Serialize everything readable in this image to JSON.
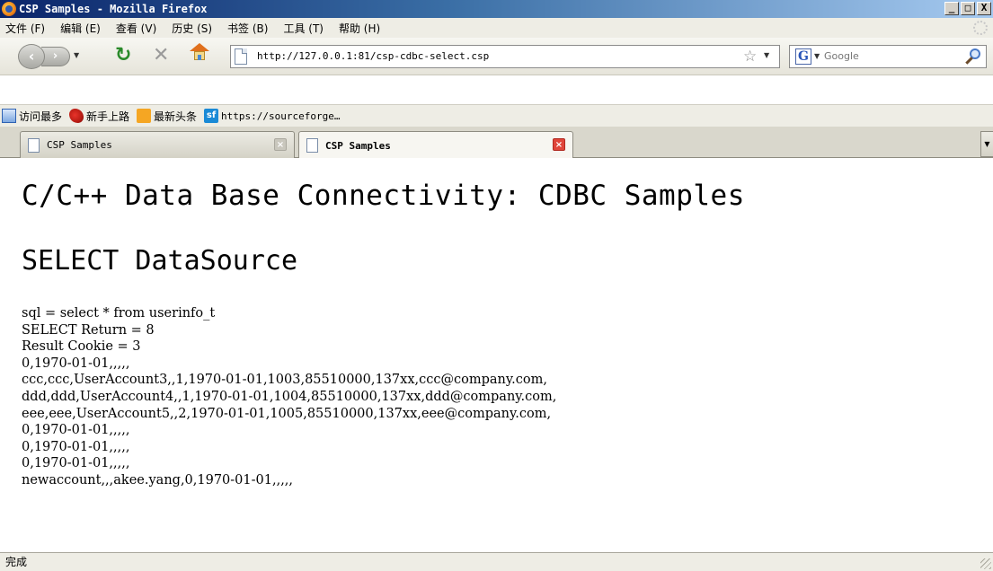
{
  "window": {
    "title": "CSP Samples - Mozilla Firefox",
    "controls": {
      "minimize": "_",
      "maximize": "□",
      "close": "X"
    }
  },
  "menu": [
    "文件 (F)",
    "编辑 (E)",
    "查看 (V)",
    "历史 (S)",
    "书签 (B)",
    "工具 (T)",
    "帮助 (H)"
  ],
  "nav": {
    "url": "http://127.0.0.1:81/csp-cdbc-select.csp",
    "search_placeholder": "Google",
    "search_engine_letter": "G",
    "icons": [
      "back-icon",
      "forward-icon",
      "reload-icon",
      "stop-icon",
      "home-icon",
      "page-icon",
      "star-icon",
      "magnifier-icon"
    ]
  },
  "bookmarks": [
    {
      "label": "访问最多",
      "icon": "most-visited-icon"
    },
    {
      "label": "新手上路",
      "icon": "getting-started-icon"
    },
    {
      "label": "最新头条",
      "icon": "rss-icon"
    },
    {
      "label": "https://sourceforge…",
      "icon": "sourceforge-icon"
    }
  ],
  "tabs": [
    {
      "label": "CSP Samples",
      "active": false
    },
    {
      "label": "CSP Samples",
      "active": true
    }
  ],
  "content": {
    "heading1": "C/C++ Data Base Connectivity: CDBC Samples",
    "heading2": "SELECT DataSource",
    "lines": [
      "sql = select * from userinfo_t",
      "SELECT Return = 8",
      "Result Cookie = 3",
      "0,1970-01-01,,,,,",
      "ccc,ccc,UserAccount3,,1,1970-01-01,1003,85510000,137xx,ccc@company.com,",
      "ddd,ddd,UserAccount4,,1,1970-01-01,1004,85510000,137xx,ddd@company.com,",
      "eee,eee,UserAccount5,,2,1970-01-01,1005,85510000,137xx,eee@company.com,",
      "0,1970-01-01,,,,,",
      "0,1970-01-01,,,,,",
      "0,1970-01-01,,,,,",
      "newaccount,,,akee.yang,0,1970-01-01,,,,,"
    ]
  },
  "status": "完成",
  "colors": {
    "titlebar_start": "#0a246a",
    "titlebar_end": "#a6caf0",
    "chrome": "#eeede5",
    "close_tab": "#e0453a"
  }
}
